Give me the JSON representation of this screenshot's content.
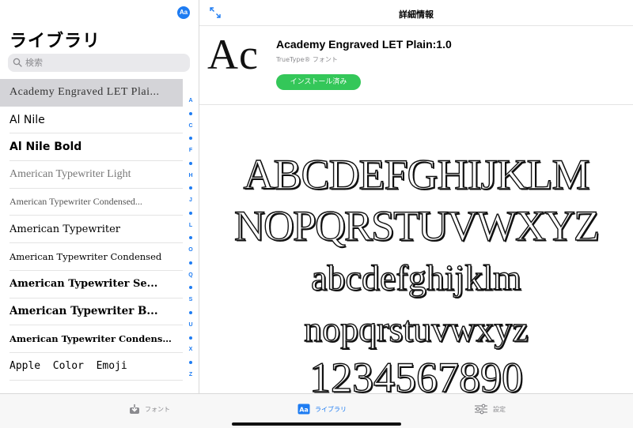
{
  "sidebar": {
    "avatar_label": "Aa",
    "title": "ライブラリ",
    "search_placeholder": "検索",
    "fonts": [
      {
        "name": "Academy Engraved LET Plain:1.0",
        "display": "Academy Engraved LET Plai...",
        "selected": true
      },
      {
        "name": "Al Nile",
        "display": "Al Nile"
      },
      {
        "name": "Al Nile Bold",
        "display": "Al Nile Bold"
      },
      {
        "name": "American Typewriter Light",
        "display": "American Typewriter Light"
      },
      {
        "name": "American Typewriter Condensed",
        "display": "American Typewriter Condensed..."
      },
      {
        "name": "American Typewriter",
        "display": "American Typewriter"
      },
      {
        "name": "American Typewriter Condensed",
        "display": "American Typewriter Condensed"
      },
      {
        "name": "American Typewriter Semibold",
        "display": "American Typewriter Se..."
      },
      {
        "name": "American Typewriter Bold",
        "display": "American Typewriter B..."
      },
      {
        "name": "American Typewriter Condensed Bold",
        "display": "American Typewriter Condense..."
      },
      {
        "name": "Apple Color Emoji",
        "display": "Apple  Color  Emoji"
      }
    ],
    "index": [
      "A",
      "•",
      "C",
      "•",
      "F",
      "•",
      "H",
      "•",
      "J",
      "•",
      "L",
      "•",
      "O",
      "•",
      "Q",
      "•",
      "S",
      "•",
      "U",
      "•",
      "X",
      "•",
      "Z"
    ]
  },
  "detail": {
    "header_title": "詳細情報",
    "preview_glyphs": "Ac",
    "font_name": "Academy Engraved LET Plain:1.0",
    "font_type": "TrueType® フォント",
    "install_status": "インストール済み",
    "samples": {
      "upper1": "ABCDEFGHIJKLM",
      "upper2": "NOPQRSTUVWXYZ",
      "lower1": "abcdefghijklm",
      "lower2": "nopqrstuvwxyz",
      "digits": "1234567890"
    }
  },
  "tabbar": {
    "fonts_label": "フォント",
    "library_label": "ライブラリ",
    "settings_label": "設定"
  },
  "colors": {
    "accent": "#1e7cf2",
    "installed": "#34c759",
    "selected_row": "#d4d4d8"
  }
}
